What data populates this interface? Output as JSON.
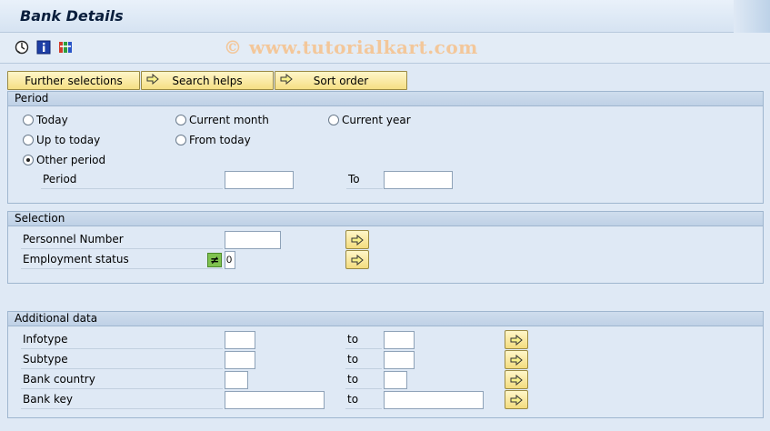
{
  "window": {
    "title": "Bank Details"
  },
  "toolbar": {
    "icons": [
      "execute-icon",
      "info-icon",
      "selection-options-icon"
    ],
    "watermark": "© www.tutorialkart.com"
  },
  "header_buttons": {
    "further_selections": "Further selections",
    "search_helps": "Search helps",
    "sort_order": "Sort order"
  },
  "period": {
    "title": "Period",
    "options": {
      "today": "Today",
      "current_month": "Current month",
      "current_year": "Current year",
      "up_to_today": "Up to today",
      "from_today": "From today",
      "other_period": "Other period"
    },
    "selected": "other_period",
    "period_label": "Period",
    "to_label": "To",
    "from_value": "",
    "to_value": ""
  },
  "selection": {
    "title": "Selection",
    "personnel_number_label": "Personnel Number",
    "personnel_number_value": "",
    "employment_status_label": "Employment status",
    "employment_status_operator": "≠",
    "employment_status_value": "0"
  },
  "additional": {
    "title": "Additional data",
    "to_label": "to",
    "rows": [
      {
        "label": "Infotype",
        "from": "",
        "to": ""
      },
      {
        "label": "Subtype",
        "from": "",
        "to": ""
      },
      {
        "label": "Bank country",
        "from": "",
        "to": ""
      },
      {
        "label": "Bank key",
        "from": "",
        "to": ""
      }
    ]
  },
  "colors": {
    "background": "#dfe9f5",
    "button": "#f5df84",
    "ne_icon": "#7fc24f",
    "watermark": "#f3c79a"
  }
}
